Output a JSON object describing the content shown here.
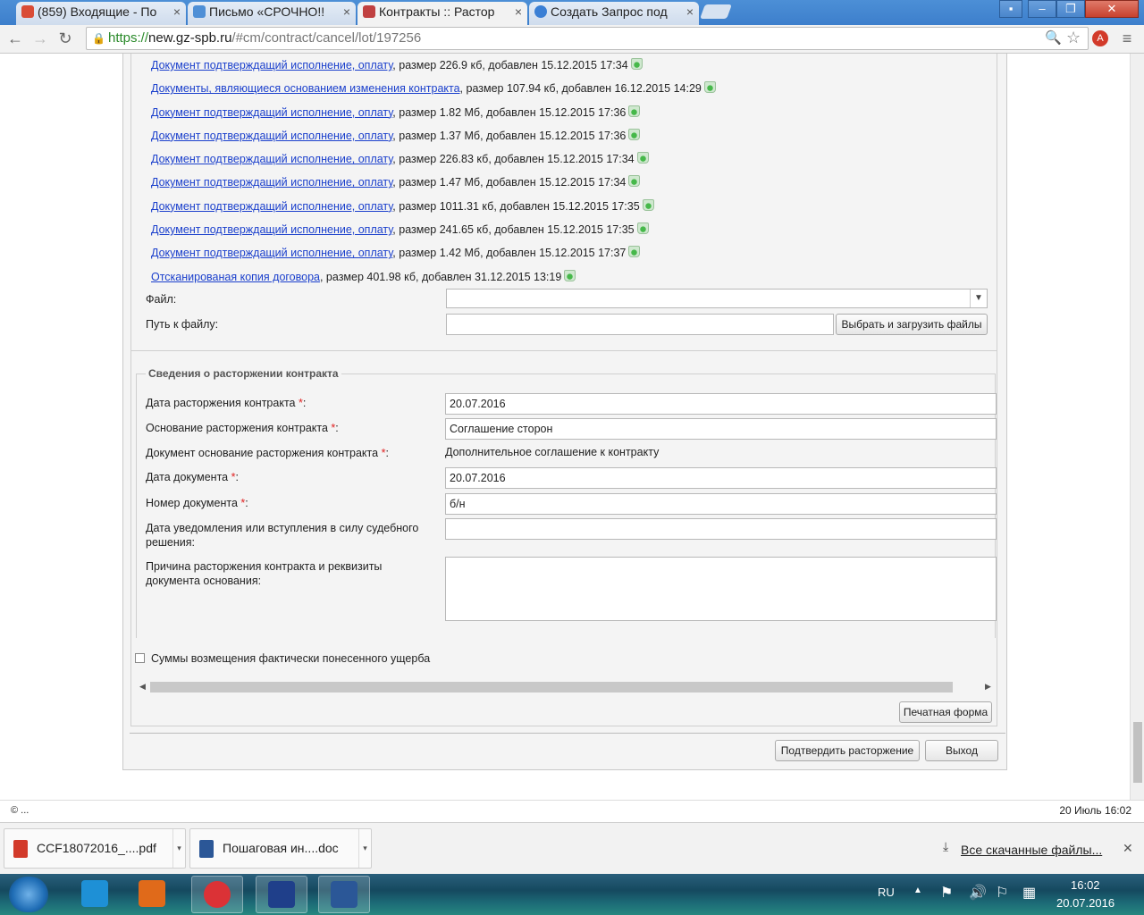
{
  "browser": {
    "tabs": [
      {
        "label": "(859) Входящие - По",
        "color": "#d94c36"
      },
      {
        "label": "Письмо «СРОЧНО!!",
        "color": "#4e8fd6"
      },
      {
        "label": "Контракты :: Растор",
        "color": "#c04040"
      },
      {
        "label": "Создать Запрос под",
        "color": "#3a7fd5"
      }
    ],
    "window_buttons": {
      "minimize": "–",
      "restore": "❐",
      "close": "✕"
    },
    "nav": {
      "back": "←",
      "forward": "→",
      "reload": "↻"
    },
    "url_scheme": "https://",
    "url_host": "new.gz-spb.ru",
    "url_path": "/#cm/contract/cancel/lot/197256",
    "zoom_icon": "🔍",
    "star": "☆",
    "menu": "≡"
  },
  "documents": [
    {
      "link": "Документ подтверждащий исполнение, оплату",
      "meta": ", размер 226.9 кб, добавлен 15.12.2015 17:34"
    },
    {
      "link": "Документы, являющиеся основанием изменения контракта",
      "meta": ", размер 107.94 кб, добавлен 16.12.2015 14:29"
    },
    {
      "link": "Документ подтверждащий исполнение, оплату",
      "meta": ", размер 1.82 Мб, добавлен 15.12.2015 17:36"
    },
    {
      "link": "Документ подтверждащий исполнение, оплату",
      "meta": ", размер 1.37 Мб, добавлен 15.12.2015 17:36"
    },
    {
      "link": "Документ подтверждащий исполнение, оплату",
      "meta": ", размер 226.83 кб, добавлен 15.12.2015 17:34"
    },
    {
      "link": "Документ подтверждащий исполнение, оплату",
      "meta": ", размер 1.47 Мб, добавлен 15.12.2015 17:34"
    },
    {
      "link": "Документ подтверждащий исполнение, оплату",
      "meta": ", размер 1011.31 кб, добавлен 15.12.2015 17:35"
    },
    {
      "link": "Документ подтверждащий исполнение, оплату",
      "meta": ", размер 241.65 кб, добавлен 15.12.2015 17:35"
    },
    {
      "link": "Документ подтверждащий исполнение, оплату",
      "meta": ", размер 1.42 Мб, добавлен 15.12.2015 17:37"
    },
    {
      "link": "Отсканированая копия договора",
      "meta": ", размер 401.98 кб, добавлен 31.12.2015 13:19"
    }
  ],
  "upload": {
    "file_label": "Файл:",
    "file_value": "",
    "path_label": "Путь к файлу:",
    "path_value": "",
    "choose_button": "Выбрать и загрузить файлы"
  },
  "termination": {
    "legend": "Сведения о расторжении контракта",
    "date_label": "Дата расторжения контракта",
    "date_value": "20.07.2016",
    "basis_label": "Основание расторжения контракта",
    "basis_value": "Соглашение сторон",
    "doc_basis_label": "Документ основание расторжения контракта",
    "doc_basis_value": "Дополнительное соглашение к контракту",
    "doc_date_label": "Дата документа",
    "doc_date_value": "20.07.2016",
    "doc_number_label": "Номер документа",
    "doc_number_value": "б/н",
    "notice_label_1": "Дата уведомления или вступления в силу судебного",
    "notice_label_2": "решения:",
    "notice_value": "",
    "reason_label_1": "Причина расторжения контракта и реквизиты",
    "reason_label_2": "документа основания:",
    "reason_value": "",
    "required_mark": "*",
    "colon": ":"
  },
  "damages_checkbox": {
    "label": "Суммы возмещения фактически понесенного ущерба",
    "checked": false
  },
  "buttons": {
    "print": "Печатная форма",
    "confirm": "Подтвердить расторжение",
    "exit": "Выход"
  },
  "status": {
    "left": "© ...",
    "right": "20 Июль 16:02"
  },
  "downloads": {
    "items": [
      {
        "name": "CCF18072016_....pdf",
        "color": "#d23a2a"
      },
      {
        "name": "Пошаговая ин....doc",
        "color": "#2b5797"
      }
    ],
    "all_label": "Все скачанные файлы...",
    "close": "✕"
  },
  "taskbar": {
    "lang": "RU",
    "time": "16:02",
    "date": "20.07.2016",
    "apps": [
      {
        "name": "ie-icon",
        "color": "#1e90d6"
      },
      {
        "name": "media-player-icon",
        "color": "#e06a1a"
      },
      {
        "name": "chrome-icon",
        "color": "#db3236"
      },
      {
        "name": "app-icon",
        "color": "#1f3f8a"
      },
      {
        "name": "word-icon",
        "color": "#2b5797"
      }
    ]
  }
}
